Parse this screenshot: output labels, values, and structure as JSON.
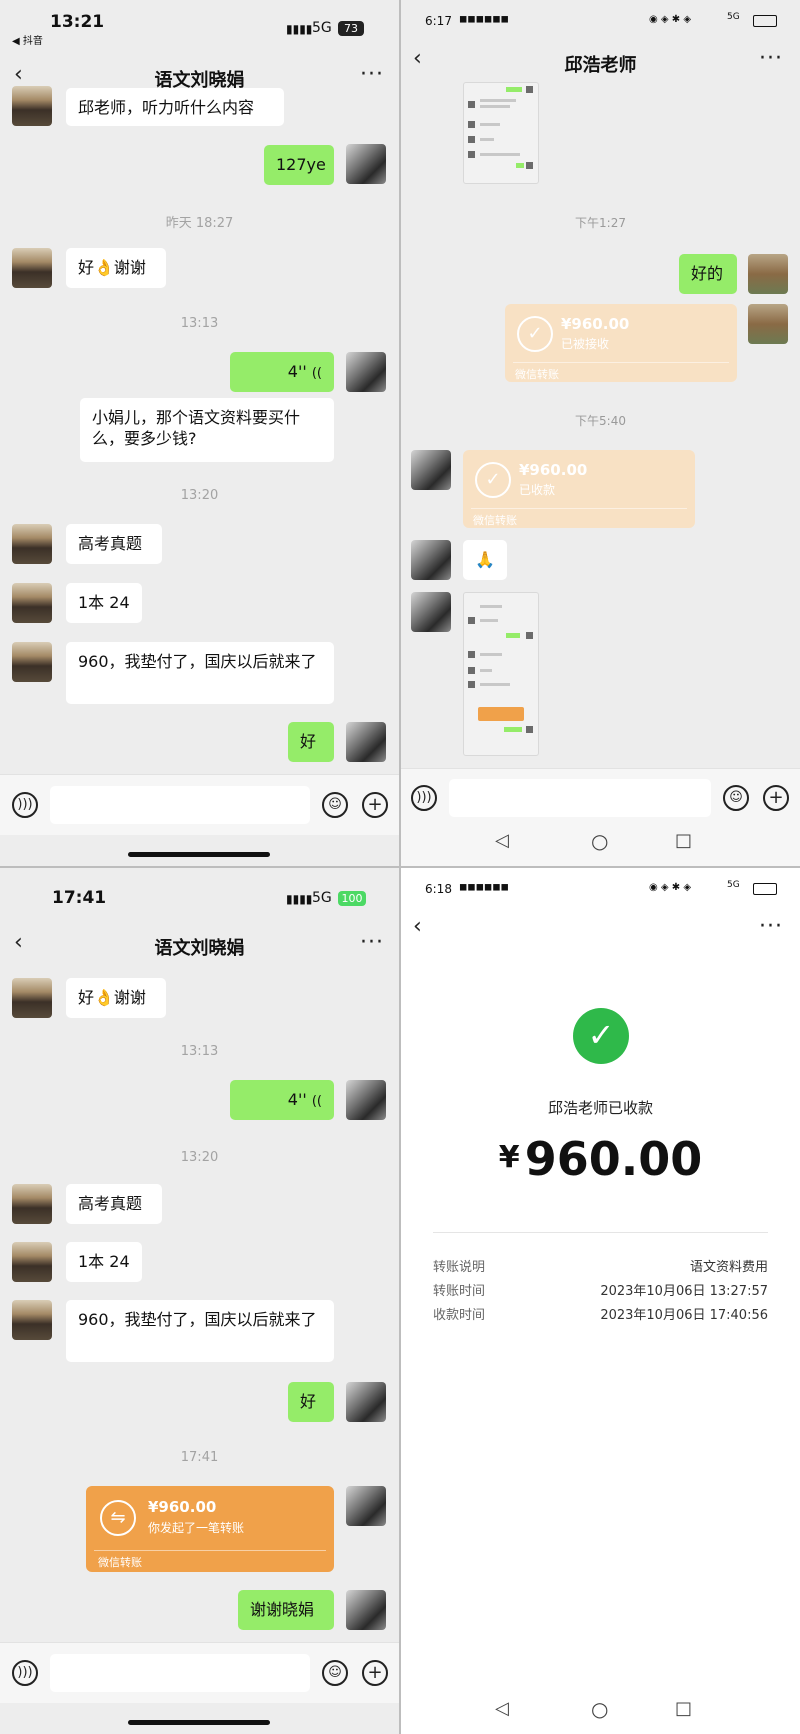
{
  "panel1": {
    "status": {
      "time": "13:21",
      "back_app": "◀ 抖音",
      "network": "5G",
      "battery": "73"
    },
    "title": "语文刘晓娟",
    "messages": {
      "partial_top": "邱老师，听力听什么内容",
      "m_127ye": "127ye",
      "ts_yesterday": "昨天 18:27",
      "m_thanks": "好👌谢谢",
      "ts_1313": "13:13",
      "voice": "4''",
      "m_ask": "小娟儿，那个语文资料要买什么，要多少钱?",
      "ts_1320": "13:20",
      "m_gaokao": "高考真题",
      "m_price": "1本 24",
      "m_960": "960，我垫付了，国庆以后就来了",
      "m_ok": "好"
    }
  },
  "panel2": {
    "status": {
      "time": "6:17",
      "right": "5G"
    },
    "title": "邱浩老师",
    "messages": {
      "ts_127": "下午1:27",
      "m_good": "好的",
      "transfer_received": {
        "amount": "¥960.00",
        "status": "已被接收",
        "foot": "微信转账"
      },
      "ts_540": "下午5:40",
      "transfer_collected": {
        "amount": "¥960.00",
        "status": "已收款",
        "foot": "微信转账"
      },
      "emoji": "🙏"
    }
  },
  "panel3": {
    "status": {
      "time": "17:41",
      "network": "5G",
      "battery": "100"
    },
    "title": "语文刘晓娟",
    "messages": {
      "m_thanks": "好👌谢谢",
      "ts_1313": "13:13",
      "voice": "4''",
      "ts_1320": "13:20",
      "m_gaokao": "高考真题",
      "m_price": "1本 24",
      "m_960": "960，我垫付了，国庆以后就来了",
      "m_ok": "好",
      "ts_1741": "17:41",
      "transfer_sent": {
        "amount": "¥960.00",
        "status": "你发起了一笔转账",
        "foot": "微信转账"
      },
      "m_thanks_xj": "谢谢晓娟"
    }
  },
  "panel4": {
    "status": {
      "time": "6:18",
      "right": "5G"
    },
    "receipt": {
      "title": "邱浩老师已收款",
      "currency": "¥",
      "amount": "960.00",
      "rows": [
        {
          "label": "转账说明",
          "value": "语文资料费用"
        },
        {
          "label": "转账时间",
          "value": "2023年10月06日 13:27:57"
        },
        {
          "label": "收款时间",
          "value": "2023年10月06日 17:40:56"
        }
      ]
    }
  },
  "colors": {
    "chat_bg": "#ededed",
    "my_bubble": "#95ec69",
    "transfer_orange": "#f0a14a",
    "transfer_pale": "#f8e1c4",
    "success_green": "#2fb94a"
  }
}
